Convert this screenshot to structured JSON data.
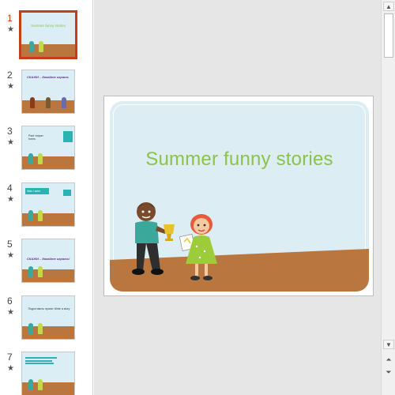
{
  "thumbnails": [
    {
      "number": "1",
      "star": "★",
      "title": "Summer funny stories",
      "active": true
    },
    {
      "number": "2",
      "star": "★",
      "title": "СКАЖИ – давайте играть",
      "active": false
    },
    {
      "number": "3",
      "star": "★",
      "title": "Past «игра» forms",
      "active": false
    },
    {
      "number": "4",
      "star": "★",
      "title": "Was / were",
      "active": false
    },
    {
      "number": "5",
      "star": "★",
      "title": "СКАЖИ – давайте играть!",
      "active": false
    },
    {
      "number": "6",
      "star": "★",
      "title": "Подготовить проект Write a story",
      "active": false
    },
    {
      "number": "7",
      "star": "★",
      "title": "",
      "active": false
    }
  ],
  "slide": {
    "title": "Summer funny stories"
  },
  "scrollbar": {
    "up": "▲",
    "down": "▼",
    "prev_slide": "⏶",
    "next_slide": "⏷"
  },
  "colors": {
    "accent_selected": "#c43e1c",
    "title_green": "#8bc34a",
    "sky": "#dcedf3",
    "ground": "#b9773f"
  }
}
